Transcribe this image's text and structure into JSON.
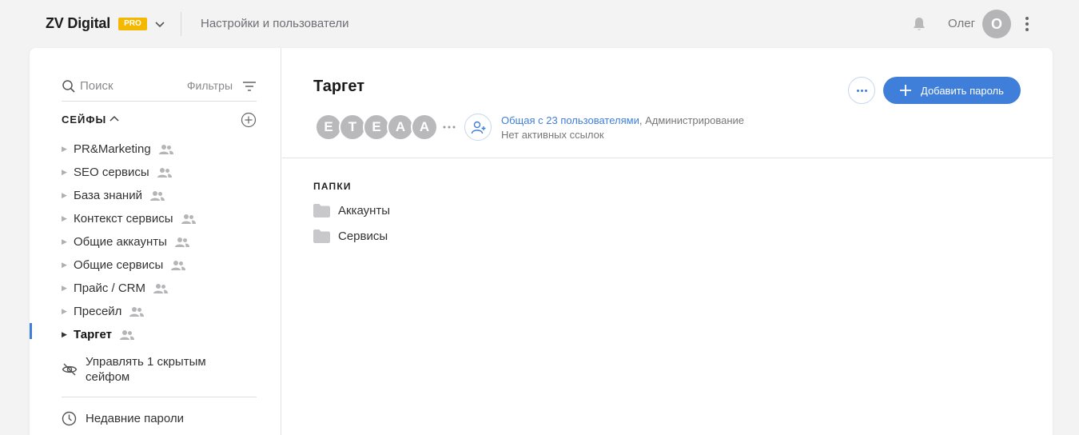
{
  "header": {
    "brand": "ZV Digital",
    "plan_badge": "PRO",
    "settings_link": "Настройки и пользователи",
    "user_name": "Олег",
    "avatar_initial": "О",
    "icons": [
      "chevron-down-icon",
      "bell-icon",
      "more-vertical-icon"
    ]
  },
  "sidebar": {
    "search_placeholder": "Поиск",
    "filters_label": "Фильтры",
    "safes_heading": "СЕЙФЫ",
    "safes": [
      {
        "label": "PR&Marketing",
        "shared": true
      },
      {
        "label": "SEO сервисы",
        "shared": true
      },
      {
        "label": "База знаний",
        "shared": true
      },
      {
        "label": "Контекст сервисы",
        "shared": true
      },
      {
        "label": "Общие аккаунты",
        "shared": true
      },
      {
        "label": "Общие сервисы",
        "shared": true
      },
      {
        "label": "Прайс / CRM",
        "shared": true
      },
      {
        "label": "Пресейл",
        "shared": true
      },
      {
        "label": "Таргет",
        "shared": true,
        "active": true
      }
    ],
    "hidden_safes_label": "Управлять 1 скрытым сейфом",
    "recent_passwords_label": "Недавние пароли"
  },
  "main": {
    "safe_title": "Таргет",
    "add_password_label": "Добавить пароль",
    "member_initials": [
      "E",
      "T",
      "E",
      "A",
      "A"
    ],
    "shared_with": "Общая с 23 пользователями",
    "access_level": ", Администрирование",
    "links_status": "Нет активных ссылок",
    "folders_heading": "ПАПКИ",
    "folders": [
      "Аккаунты",
      "Сервисы"
    ]
  },
  "colors": {
    "accent": "#3f7fd9",
    "pro_badge": "#f5b800",
    "background": "#f3f3f4",
    "avatar_gray": "#b9b9bc"
  }
}
